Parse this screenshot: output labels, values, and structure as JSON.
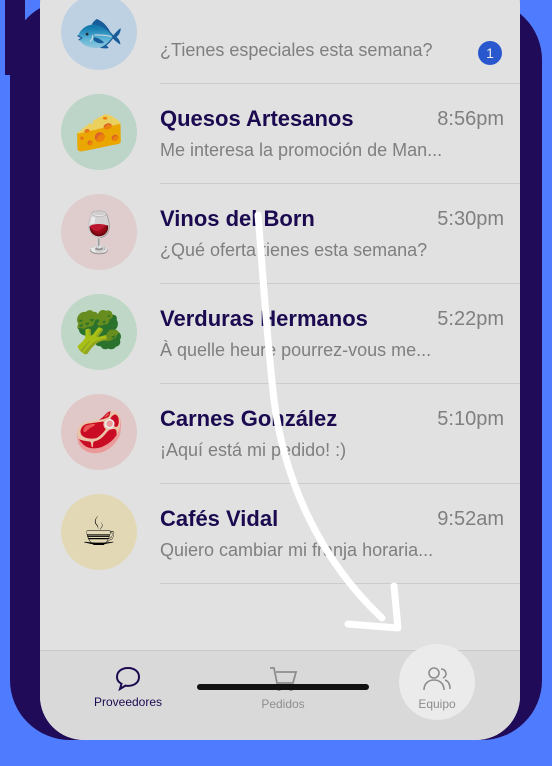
{
  "colors": {
    "background_blue": "#4f7cff",
    "frame_purple": "#1f0b57",
    "accent_blue": "#2d5fe0"
  },
  "chats": [
    {
      "avatar_icon": "fish-icon",
      "avatar_emoji": "🐟",
      "avatar_bg": "#cfe3f7",
      "name": "",
      "time": "",
      "preview": "¿Tienes especiales esta semana?",
      "unread": "1"
    },
    {
      "avatar_icon": "cheese-icon",
      "avatar_emoji": "🧀",
      "avatar_bg": "#cde8d9",
      "name": "Quesos Artesanos",
      "time": "8:56pm",
      "preview": "Me interesa la promoción de Man..."
    },
    {
      "avatar_icon": "wine-glass-icon",
      "avatar_emoji": "🍷",
      "avatar_bg": "#f2dede",
      "name": "Vinos del Born",
      "time": "5:30pm",
      "preview": "¿Qué oferta tienes esta semana?"
    },
    {
      "avatar_icon": "broccoli-icon",
      "avatar_emoji": "🥦",
      "avatar_bg": "#d0ead8",
      "name": "Verduras Hermanos",
      "time": "5:22pm",
      "preview": "À quelle heure pourrez-vous me..."
    },
    {
      "avatar_icon": "steak-icon",
      "avatar_emoji": "🥩",
      "avatar_bg": "#f5dada",
      "name": "Carnes González",
      "time": "5:10pm",
      "preview": "¡Aquí está mi pedido! :)"
    },
    {
      "avatar_icon": "coffee-cup-icon",
      "avatar_emoji": "☕",
      "avatar_bg": "#f6ebc6",
      "name": "Cafés Vidal",
      "time": "9:52am",
      "preview": "Quiero cambiar mi franja horaria..."
    }
  ],
  "tabs": [
    {
      "label": "Proveedores",
      "icon": "chat-bubble-icon",
      "active": true
    },
    {
      "label": "Pedidos",
      "icon": "cart-icon",
      "active": false
    },
    {
      "label": "Equipo",
      "icon": "people-icon",
      "active": false
    }
  ]
}
